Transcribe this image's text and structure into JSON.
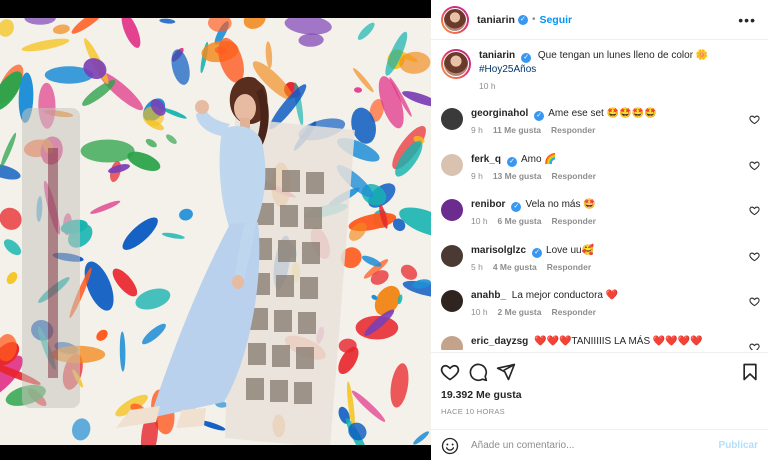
{
  "post": {
    "author": "taniarin",
    "follow_label": "Seguir",
    "more_label": "•••",
    "separator": "•"
  },
  "caption": {
    "author": "taniarin",
    "text": "Que tengan un lunes lleno de color 🌼",
    "hashtag": "#Hoy25Años",
    "time": "10 h"
  },
  "comments": [
    {
      "user": "georginahol",
      "verified": true,
      "text": "Ame ese set 🤩🤩🤩🤩",
      "time": "9 h",
      "likes": "11 Me gusta",
      "reply": "Responder"
    },
    {
      "user": "ferk_q",
      "verified": true,
      "text": "Amo 🌈",
      "time": "9 h",
      "likes": "13 Me gusta",
      "reply": "Responder"
    },
    {
      "user": "renibor",
      "verified": true,
      "text": "Vela no más 🤩",
      "time": "10 h",
      "likes": "6 Me gusta",
      "reply": "Responder"
    },
    {
      "user": "marisolglzc",
      "verified": true,
      "text": "Love uu🥰",
      "time": "5 h",
      "likes": "4 Me gusta",
      "reply": "Responder"
    },
    {
      "user": "anahb_",
      "verified": false,
      "text": "La mejor conductora ❤️",
      "time": "10 h",
      "likes": "2 Me gusta",
      "reply": "Responder"
    },
    {
      "user": "eric_dayzsg",
      "verified": false,
      "text": "❤️❤️❤️TANIIIIIS LA MÁS ❤️❤️❤️❤️",
      "time": "",
      "likes": "",
      "reply": ""
    }
  ],
  "stats": {
    "likes": "19.392 Me gusta",
    "time": "HACE 10 HORAS"
  },
  "composer": {
    "placeholder": "Añade un comentario...",
    "publish_label": "Publicar"
  },
  "colors": {
    "accent": "#0095f6",
    "verified": "#3897f0",
    "muted": "#8e8e8e",
    "publish_disabled": "#b2dffc"
  },
  "icons": [
    "heart-icon",
    "comment-icon",
    "share-icon",
    "bookmark-icon",
    "emoji-icon",
    "more-options-icon",
    "verified-badge-icon"
  ]
}
